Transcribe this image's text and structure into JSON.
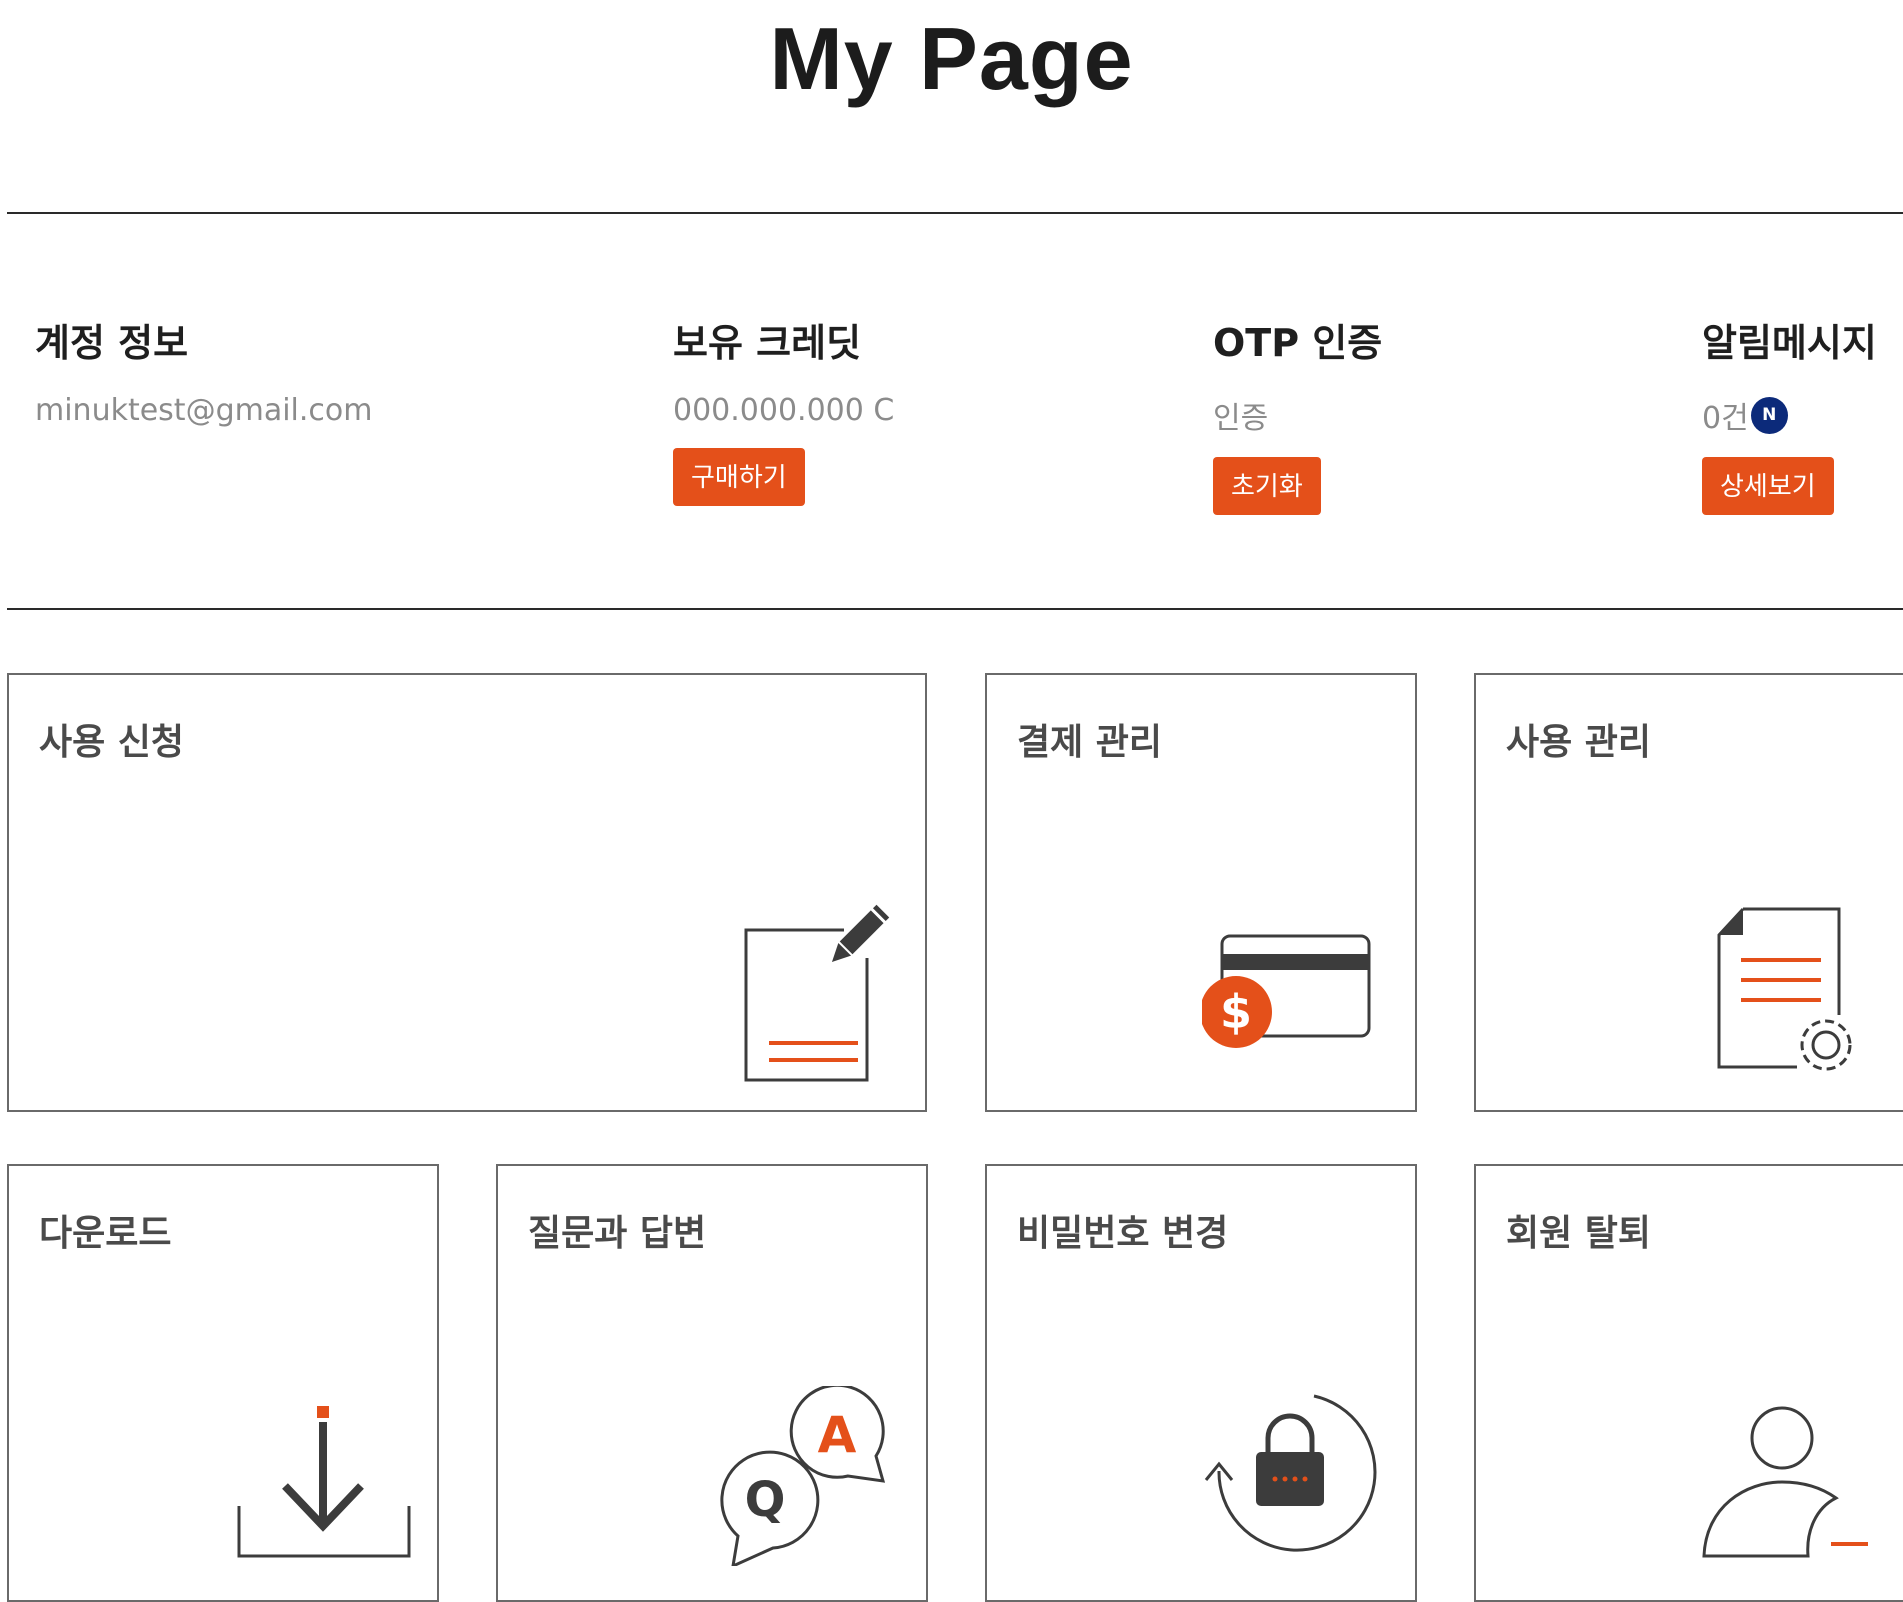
{
  "page": {
    "title": "My Page"
  },
  "colors": {
    "accent": "#e4501a",
    "badge": "#0c2a7a",
    "icon_stroke": "#3c3c3c"
  },
  "summary": {
    "account": {
      "label": "계정 정보",
      "value": "minuktest@gmail.com"
    },
    "credit": {
      "label": "보유 크레딧",
      "value": "000.000.000 C",
      "button": "구매하기"
    },
    "otp": {
      "label": "OTP 인증",
      "value": "인증",
      "button": "초기화"
    },
    "notice": {
      "label": "알림메시지",
      "value": "0건",
      "badge": "N",
      "button": "상세보기"
    }
  },
  "cards": {
    "apply": {
      "title": "사용 신청",
      "icon": "document-edit-icon"
    },
    "payment": {
      "title": "결제 관리",
      "icon": "credit-card-dollar-icon"
    },
    "usage": {
      "title": "사용 관리",
      "icon": "document-gear-icon"
    },
    "download": {
      "title": "다운로드",
      "icon": "download-icon"
    },
    "qna": {
      "title": "질문과 답변",
      "icon": "qa-bubbles-icon"
    },
    "password": {
      "title": "비밀번호 변경",
      "icon": "lock-refresh-icon"
    },
    "withdraw": {
      "title": "회원 탈퇴",
      "icon": "user-remove-icon"
    }
  }
}
